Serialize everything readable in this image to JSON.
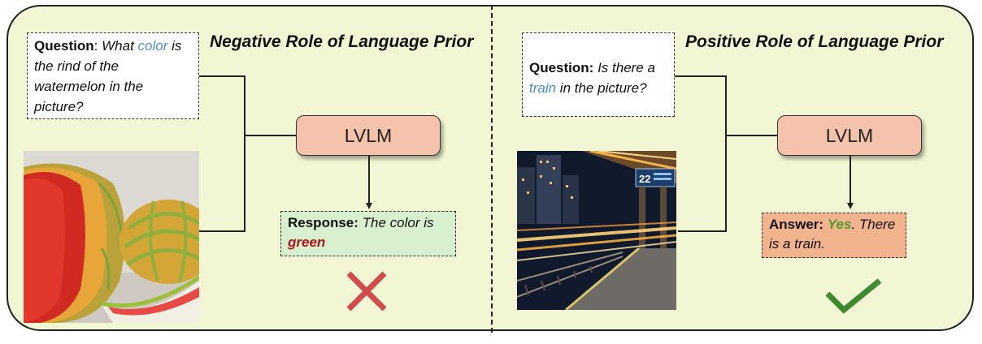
{
  "left": {
    "title": "Negative Role of Language Prior",
    "question": {
      "label": "Question",
      "sep": ": ",
      "text_before": "What ",
      "highlight": "color",
      "text_after": " is the rind of the watermelon in the picture?"
    },
    "model": "LVLM",
    "response": {
      "label": "Response:",
      "text": " The color is ",
      "answer": "green"
    },
    "verdict_icon": "cross-icon",
    "verdict_color": "#d24b4b"
  },
  "right": {
    "title": "Positive Role of Language Prior",
    "question": {
      "label": "Question:",
      "text_before": " Is there a ",
      "highlight": "train",
      "text_after": " in the picture?"
    },
    "model": "LVLM",
    "answer": {
      "label": "Answer:",
      "yes": "Yes",
      "text": ". There is a train."
    },
    "sign_number": "22",
    "verdict_icon": "check-icon",
    "verdict_color": "#3e8a2e"
  },
  "colors": {
    "panel_bg": "#f2f6d4",
    "lvlm_fill": "#f5c3ab",
    "response_fill": "#d9f0d0",
    "answer_fill": "#f2b48e",
    "highlight": "#4f8fcf",
    "wrong_answer": "#b3121b",
    "right_answer": "#4a9a2a"
  }
}
